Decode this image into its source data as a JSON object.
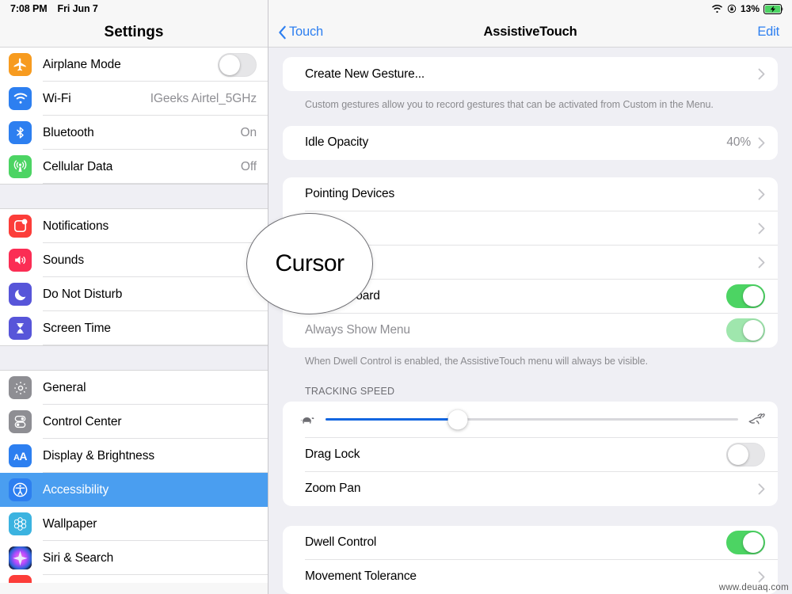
{
  "status_bar": {
    "time": "7:08 PM",
    "date": "Fri Jun 7",
    "wifi_icon": "wifi-icon",
    "orientation_lock_icon": "rotation-lock-icon",
    "battery_percent": "13%",
    "battery_icon": "battery-charging-icon"
  },
  "sidebar": {
    "title": "Settings",
    "groups": [
      {
        "items": [
          {
            "label": "Airplane Mode",
            "icon": "airplane-icon",
            "icon_color": "#f79b1f",
            "control": "toggle",
            "toggle_on": false
          },
          {
            "label": "Wi-Fi",
            "icon": "wifi-icon",
            "icon_color": "#2d7ff0",
            "control": "value",
            "value": "IGeeks Airtel_5GHz"
          },
          {
            "label": "Bluetooth",
            "icon": "bluetooth-icon",
            "icon_color": "#2d7ff0",
            "control": "value",
            "value": "On"
          },
          {
            "label": "Cellular Data",
            "icon": "cellular-icon",
            "icon_color": "#4cd463",
            "control": "value",
            "value": "Off"
          }
        ]
      },
      {
        "items": [
          {
            "label": "Notifications",
            "icon": "notifications-icon",
            "icon_color": "#fc3d39",
            "control": "none"
          },
          {
            "label": "Sounds",
            "icon": "sounds-icon",
            "icon_color": "#fb2d54",
            "control": "none"
          },
          {
            "label": "Do Not Disturb",
            "icon": "moon-icon",
            "icon_color": "#5755d9",
            "control": "none"
          },
          {
            "label": "Screen Time",
            "icon": "hourglass-icon",
            "icon_color": "#5755d9",
            "control": "none"
          }
        ]
      },
      {
        "items": [
          {
            "label": "General",
            "icon": "gear-icon",
            "icon_color": "#8e8e93",
            "control": "none"
          },
          {
            "label": "Control Center",
            "icon": "control-center-icon",
            "icon_color": "#8e8e93",
            "control": "none"
          },
          {
            "label": "Display & Brightness",
            "icon": "display-brightness-icon",
            "icon_color": "#2d7ff0",
            "control": "none"
          },
          {
            "label": "Accessibility",
            "icon": "accessibility-icon",
            "icon_color": "#2d7ff0",
            "control": "none",
            "selected": true
          },
          {
            "label": "Wallpaper",
            "icon": "wallpaper-icon",
            "icon_color": "#3bb3e0",
            "control": "none"
          },
          {
            "label": "Siri & Search",
            "icon": "siri-icon",
            "icon_color": "#1b1b2b",
            "control": "none"
          }
        ]
      }
    ],
    "selected_item": "Accessibility",
    "accent_color": "#4a9ef0"
  },
  "navbar": {
    "back_label": "Touch",
    "back_icon": "chevron-left-icon",
    "title": "AssistiveTouch",
    "edit_label": "Edit",
    "link_color": "#2d7ff0"
  },
  "main": {
    "sections": [
      {
        "rows": [
          {
            "label": "Create New Gesture...",
            "control": "chevron"
          }
        ],
        "footnote": "Custom gestures allow you to record gestures that can be activated from Custom in the Menu."
      },
      {
        "rows": [
          {
            "label": "Idle Opacity",
            "value": "40%",
            "control": "chevron"
          }
        ]
      },
      {
        "rows": [
          {
            "label": "Pointing Devices",
            "control": "chevron"
          },
          {
            "label": "",
            "control": "chevron",
            "obscured": true
          },
          {
            "label": "",
            "control": "chevron",
            "obscured": true
          },
          {
            "label": "een Keyboard",
            "control": "toggle",
            "toggle_on": true,
            "partially_obscured": true
          },
          {
            "label": "Always Show Menu",
            "control": "toggle",
            "toggle_on": true,
            "toggle_faded": true,
            "dim": true
          }
        ],
        "footnote": "When Dwell Control is enabled, the AssistiveTouch menu will always be visible."
      },
      {
        "group_header": "TRACKING SPEED",
        "rows": [
          {
            "control": "slider",
            "slider_value": 32,
            "slider_min_icon": "tortoise-icon",
            "slider_max_icon": "hare-icon"
          },
          {
            "label": "Drag Lock",
            "control": "toggle",
            "toggle_on": false
          },
          {
            "label": "Zoom Pan",
            "control": "chevron"
          }
        ]
      },
      {
        "rows": [
          {
            "label": "Dwell Control",
            "control": "toggle",
            "toggle_on": true
          },
          {
            "label": "Movement Tolerance",
            "control": "chevron"
          }
        ]
      }
    ]
  },
  "magnifier": {
    "text": "Cursor",
    "border_color": "#6e6e73"
  },
  "watermark": "www.deuaq.com"
}
